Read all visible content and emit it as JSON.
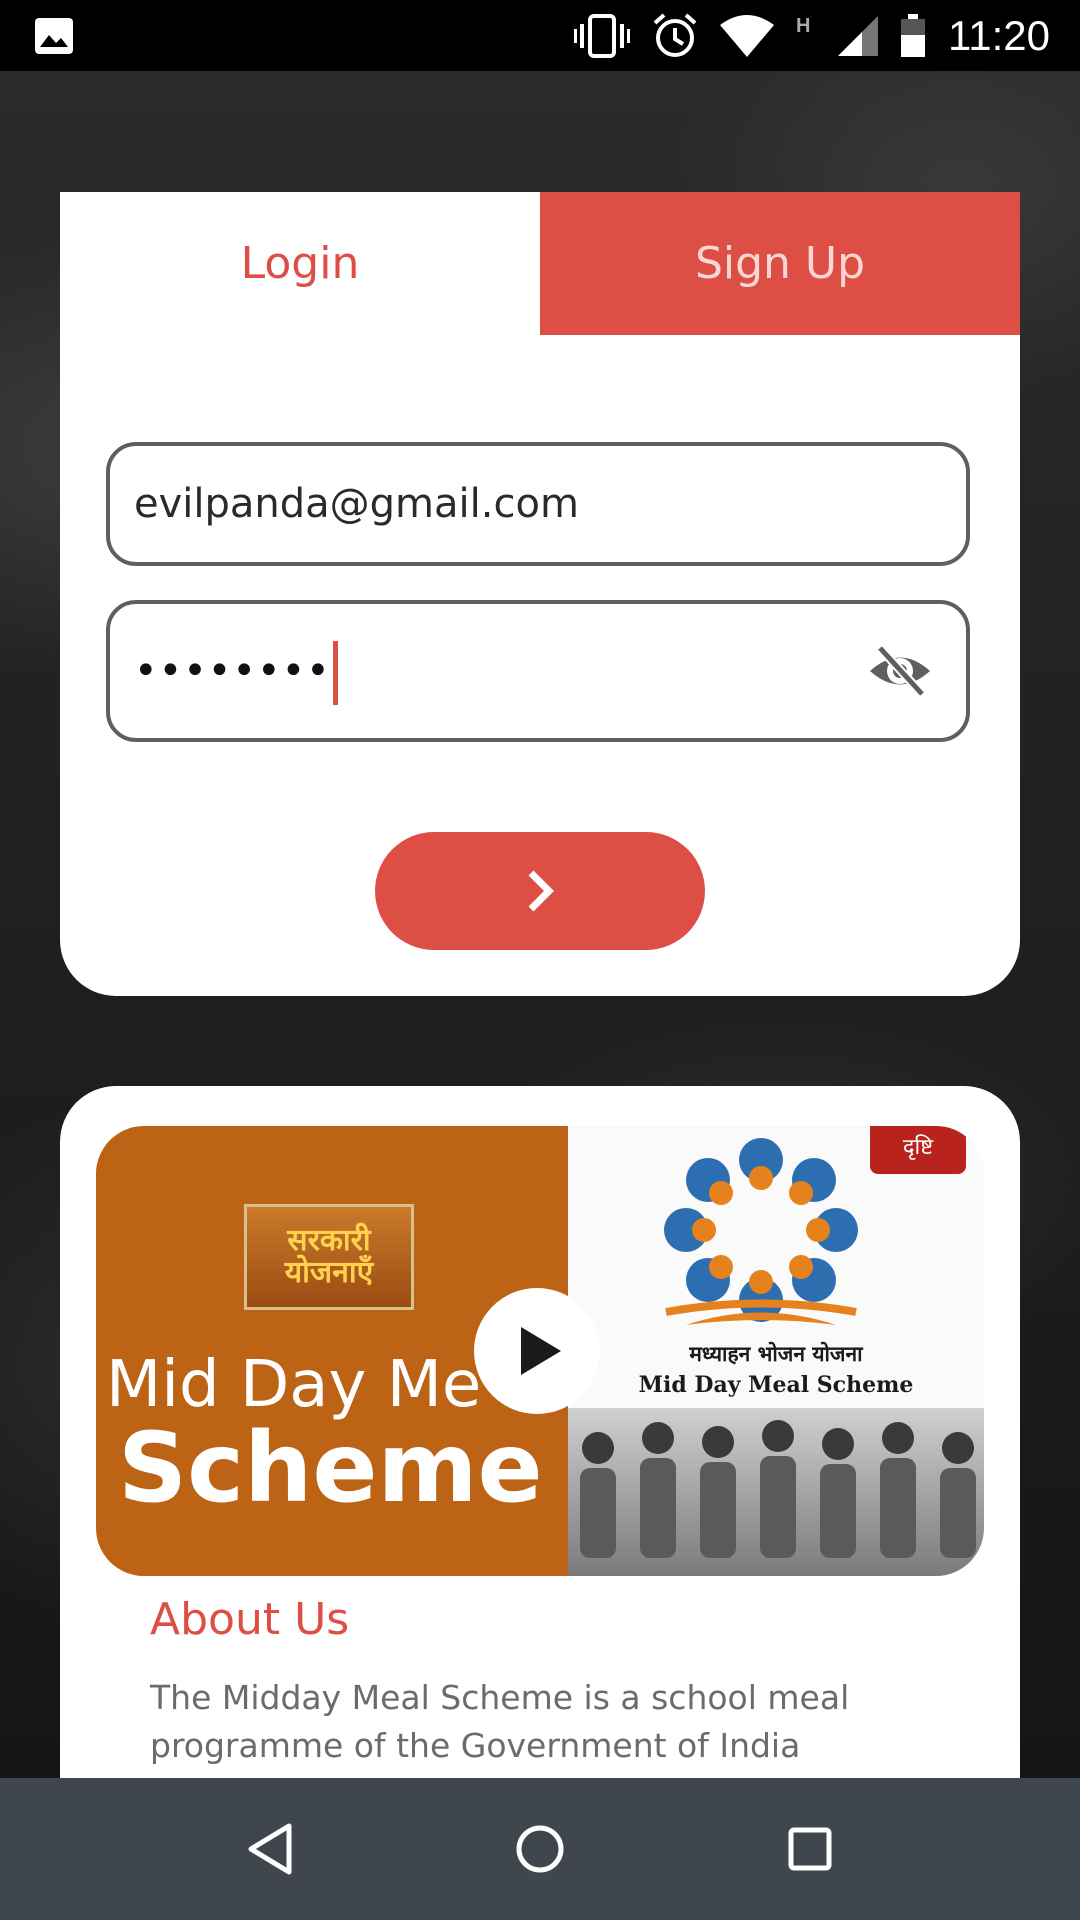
{
  "status_bar": {
    "time": "11:20",
    "icons": [
      "gallery-icon",
      "vibrate-icon",
      "alarm-icon",
      "wifi-icon",
      "network-h-icon",
      "signal-icon",
      "battery-icon"
    ]
  },
  "tabs": {
    "login_label": "Login",
    "signup_label": "Sign Up"
  },
  "form": {
    "email_value": "evilpanda@gmail.com",
    "password_masked": "••••••••"
  },
  "video": {
    "logo_text": "सरकारी योजनाएँ",
    "title_line1": "Mid Day Me",
    "title_line2": "Scheme",
    "badge_text": "दृष्टि",
    "hindi_caption": "मध्याहन भोजन योजना",
    "scheme_caption": "Mid Day Meal Scheme"
  },
  "about": {
    "title": "About Us",
    "text": "The Midday Meal Scheme is a school meal programme of the Government of India"
  },
  "colors": {
    "accent": "#dd4f45",
    "signup_text": "#f8d6d2",
    "thumb_orange": "#bd6316",
    "nav_bar": "#3f464d"
  }
}
